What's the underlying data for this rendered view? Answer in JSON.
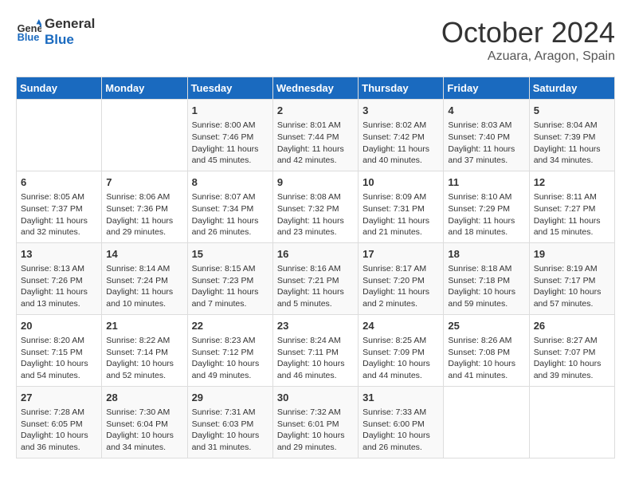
{
  "header": {
    "logo_general": "General",
    "logo_blue": "Blue",
    "month": "October 2024",
    "location": "Azuara, Aragon, Spain"
  },
  "days_of_week": [
    "Sunday",
    "Monday",
    "Tuesday",
    "Wednesday",
    "Thursday",
    "Friday",
    "Saturday"
  ],
  "weeks": [
    [
      {
        "day": "",
        "info": ""
      },
      {
        "day": "",
        "info": ""
      },
      {
        "day": "1",
        "info": "Sunrise: 8:00 AM\nSunset: 7:46 PM\nDaylight: 11 hours and 45 minutes."
      },
      {
        "day": "2",
        "info": "Sunrise: 8:01 AM\nSunset: 7:44 PM\nDaylight: 11 hours and 42 minutes."
      },
      {
        "day": "3",
        "info": "Sunrise: 8:02 AM\nSunset: 7:42 PM\nDaylight: 11 hours and 40 minutes."
      },
      {
        "day": "4",
        "info": "Sunrise: 8:03 AM\nSunset: 7:40 PM\nDaylight: 11 hours and 37 minutes."
      },
      {
        "day": "5",
        "info": "Sunrise: 8:04 AM\nSunset: 7:39 PM\nDaylight: 11 hours and 34 minutes."
      }
    ],
    [
      {
        "day": "6",
        "info": "Sunrise: 8:05 AM\nSunset: 7:37 PM\nDaylight: 11 hours and 32 minutes."
      },
      {
        "day": "7",
        "info": "Sunrise: 8:06 AM\nSunset: 7:36 PM\nDaylight: 11 hours and 29 minutes."
      },
      {
        "day": "8",
        "info": "Sunrise: 8:07 AM\nSunset: 7:34 PM\nDaylight: 11 hours and 26 minutes."
      },
      {
        "day": "9",
        "info": "Sunrise: 8:08 AM\nSunset: 7:32 PM\nDaylight: 11 hours and 23 minutes."
      },
      {
        "day": "10",
        "info": "Sunrise: 8:09 AM\nSunset: 7:31 PM\nDaylight: 11 hours and 21 minutes."
      },
      {
        "day": "11",
        "info": "Sunrise: 8:10 AM\nSunset: 7:29 PM\nDaylight: 11 hours and 18 minutes."
      },
      {
        "day": "12",
        "info": "Sunrise: 8:11 AM\nSunset: 7:27 PM\nDaylight: 11 hours and 15 minutes."
      }
    ],
    [
      {
        "day": "13",
        "info": "Sunrise: 8:13 AM\nSunset: 7:26 PM\nDaylight: 11 hours and 13 minutes."
      },
      {
        "day": "14",
        "info": "Sunrise: 8:14 AM\nSunset: 7:24 PM\nDaylight: 11 hours and 10 minutes."
      },
      {
        "day": "15",
        "info": "Sunrise: 8:15 AM\nSunset: 7:23 PM\nDaylight: 11 hours and 7 minutes."
      },
      {
        "day": "16",
        "info": "Sunrise: 8:16 AM\nSunset: 7:21 PM\nDaylight: 11 hours and 5 minutes."
      },
      {
        "day": "17",
        "info": "Sunrise: 8:17 AM\nSunset: 7:20 PM\nDaylight: 11 hours and 2 minutes."
      },
      {
        "day": "18",
        "info": "Sunrise: 8:18 AM\nSunset: 7:18 PM\nDaylight: 10 hours and 59 minutes."
      },
      {
        "day": "19",
        "info": "Sunrise: 8:19 AM\nSunset: 7:17 PM\nDaylight: 10 hours and 57 minutes."
      }
    ],
    [
      {
        "day": "20",
        "info": "Sunrise: 8:20 AM\nSunset: 7:15 PM\nDaylight: 10 hours and 54 minutes."
      },
      {
        "day": "21",
        "info": "Sunrise: 8:22 AM\nSunset: 7:14 PM\nDaylight: 10 hours and 52 minutes."
      },
      {
        "day": "22",
        "info": "Sunrise: 8:23 AM\nSunset: 7:12 PM\nDaylight: 10 hours and 49 minutes."
      },
      {
        "day": "23",
        "info": "Sunrise: 8:24 AM\nSunset: 7:11 PM\nDaylight: 10 hours and 46 minutes."
      },
      {
        "day": "24",
        "info": "Sunrise: 8:25 AM\nSunset: 7:09 PM\nDaylight: 10 hours and 44 minutes."
      },
      {
        "day": "25",
        "info": "Sunrise: 8:26 AM\nSunset: 7:08 PM\nDaylight: 10 hours and 41 minutes."
      },
      {
        "day": "26",
        "info": "Sunrise: 8:27 AM\nSunset: 7:07 PM\nDaylight: 10 hours and 39 minutes."
      }
    ],
    [
      {
        "day": "27",
        "info": "Sunrise: 7:28 AM\nSunset: 6:05 PM\nDaylight: 10 hours and 36 minutes."
      },
      {
        "day": "28",
        "info": "Sunrise: 7:30 AM\nSunset: 6:04 PM\nDaylight: 10 hours and 34 minutes."
      },
      {
        "day": "29",
        "info": "Sunrise: 7:31 AM\nSunset: 6:03 PM\nDaylight: 10 hours and 31 minutes."
      },
      {
        "day": "30",
        "info": "Sunrise: 7:32 AM\nSunset: 6:01 PM\nDaylight: 10 hours and 29 minutes."
      },
      {
        "day": "31",
        "info": "Sunrise: 7:33 AM\nSunset: 6:00 PM\nDaylight: 10 hours and 26 minutes."
      },
      {
        "day": "",
        "info": ""
      },
      {
        "day": "",
        "info": ""
      }
    ]
  ]
}
